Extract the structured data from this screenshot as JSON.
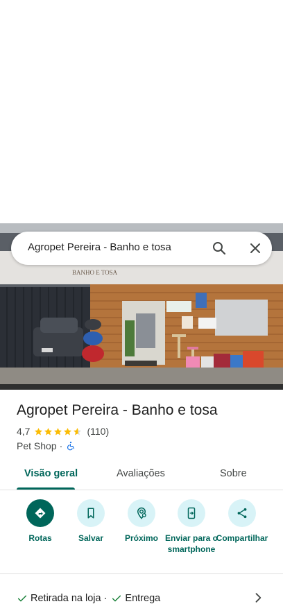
{
  "search": {
    "query": "Agropet Pereira - Banho e tosa"
  },
  "photo": {
    "sign_text": "BANHO E TOSA"
  },
  "place": {
    "title": "Agropet Pereira - Banho e tosa",
    "rating": "4,7",
    "rating_value": 4.7,
    "stars_max": 5,
    "reviews": "(110)",
    "category": "Pet Shop",
    "separator": "·"
  },
  "tabs": [
    {
      "label": "Visão geral",
      "active": true
    },
    {
      "label": "Avaliações",
      "active": false
    },
    {
      "label": "Sobre",
      "active": false
    }
  ],
  "actions": [
    {
      "label": "Rotas",
      "icon": "directions-icon"
    },
    {
      "label": "Salvar",
      "icon": "bookmark-icon"
    },
    {
      "label": "Próximo",
      "icon": "nearby-icon"
    },
    {
      "label": "Enviar para o smartphone",
      "icon": "send-to-phone-icon"
    },
    {
      "label": "Compartilhar",
      "icon": "share-icon"
    }
  ],
  "features": {
    "item1": "Retirada na loja",
    "separator": "·",
    "item2": "Entrega"
  },
  "colors": {
    "accent": "#00665a",
    "action_bg": "#d8f3f7",
    "star": "#fbbc04"
  }
}
